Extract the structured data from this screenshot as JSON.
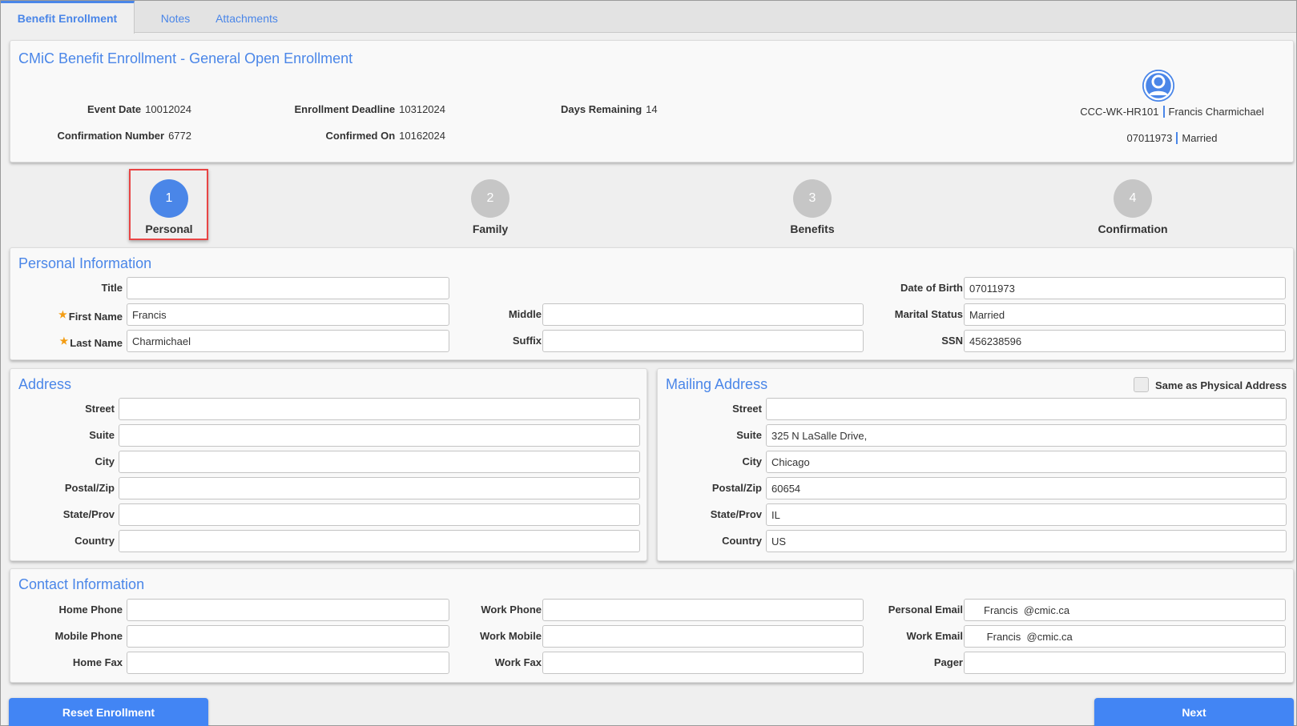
{
  "tabs": [
    {
      "label": "Benefit Enrollment",
      "active": true
    },
    {
      "label": "Notes",
      "active": false
    },
    {
      "label": "Attachments",
      "active": false
    }
  ],
  "header": {
    "title": "CMiC Benefit Enrollment - General Open Enrollment",
    "event_date_label": "Event Date",
    "event_date": "10012024",
    "deadline_label": "Enrollment Deadline",
    "deadline": "10312024",
    "days_remaining_label": "Days Remaining",
    "days_remaining": "14",
    "confirmation_number_label": "Confirmation Number",
    "confirmation_number": "6772",
    "confirmed_on_label": "Confirmed On",
    "confirmed_on": "10162024",
    "employee_id": "CCC-WK-HR101",
    "employee_name": "Francis Charmichael",
    "employee_dob": "07011973",
    "employee_marital": "Married",
    "avatar_icon": "user-circle-icon"
  },
  "steps": [
    {
      "number": "1",
      "label": "Personal",
      "active": true
    },
    {
      "number": "2",
      "label": "Family",
      "active": false
    },
    {
      "number": "3",
      "label": "Benefits",
      "active": false
    },
    {
      "number": "4",
      "label": "Confirmation",
      "active": false
    }
  ],
  "personal": {
    "title": "Personal Information",
    "fields": {
      "title": {
        "label": "Title",
        "value": ""
      },
      "first_name": {
        "label": "First Name",
        "value": "Francis",
        "required": true
      },
      "last_name": {
        "label": "Last Name",
        "value": "Charmichael",
        "required": true
      },
      "middle": {
        "label": "Middle",
        "value": ""
      },
      "suffix": {
        "label": "Suffix",
        "value": ""
      },
      "dob": {
        "label": "Date of Birth",
        "value": "07011973"
      },
      "marital": {
        "label": "Marital Status",
        "value": "Married"
      },
      "ssn": {
        "label": "SSN",
        "value": "456238596"
      }
    },
    "required_marker": "★"
  },
  "address": {
    "title": "Address",
    "fields": [
      {
        "label": "Street",
        "value": ""
      },
      {
        "label": "Suite",
        "value": ""
      },
      {
        "label": "City",
        "value": ""
      },
      {
        "label": "Postal/Zip",
        "value": ""
      },
      {
        "label": "State/Prov",
        "value": ""
      },
      {
        "label": "Country",
        "value": ""
      }
    ]
  },
  "mailing": {
    "title": "Mailing Address",
    "same_as_label": "Same as Physical Address",
    "same_as_checked": false,
    "fields": [
      {
        "label": "Street",
        "value": ""
      },
      {
        "label": "Suite",
        "value": "325 N LaSalle Drive,"
      },
      {
        "label": "City",
        "value": "Chicago"
      },
      {
        "label": "Postal/Zip",
        "value": "60654"
      },
      {
        "label": "State/Prov",
        "value": "IL"
      },
      {
        "label": "Country",
        "value": "US"
      }
    ]
  },
  "contact": {
    "title": "Contact Information",
    "fields": {
      "home_phone": {
        "label": "Home Phone",
        "value": ""
      },
      "mobile_phone": {
        "label": "Mobile Phone",
        "value": ""
      },
      "home_fax": {
        "label": "Home Fax",
        "value": ""
      },
      "work_phone": {
        "label": "Work Phone",
        "value": ""
      },
      "work_mobile": {
        "label": "Work Mobile",
        "value": ""
      },
      "work_fax": {
        "label": "Work Fax",
        "value": ""
      },
      "personal_email": {
        "label": "Personal Email",
        "value": "     Francis  @cmic.ca"
      },
      "work_email": {
        "label": "Work Email",
        "value": "      Francis  @cmic.ca"
      },
      "pager": {
        "label": "Pager",
        "value": ""
      }
    }
  },
  "buttons": {
    "reset": "Reset Enrollment",
    "next": "Next"
  },
  "colors": {
    "accent": "#4a86e8",
    "button": "#4285f4",
    "step_inactive": "#c6c6c6",
    "highlight": "#e84545",
    "required": "#f39c12"
  }
}
